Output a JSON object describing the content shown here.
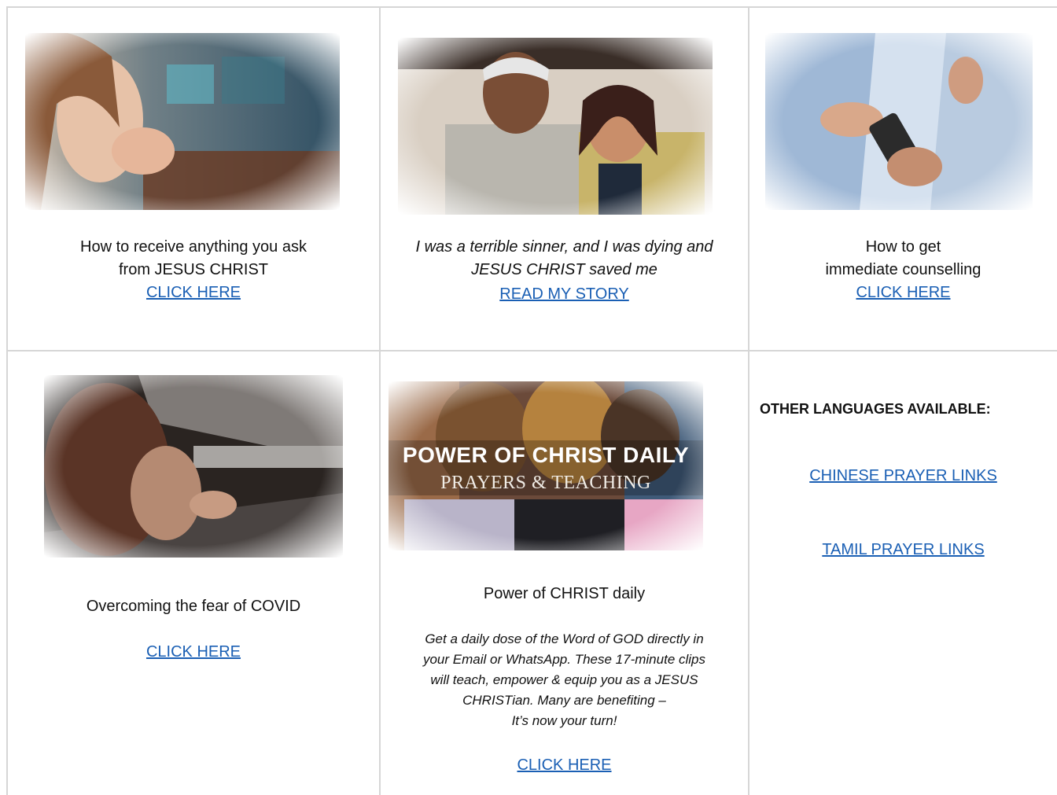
{
  "cards": [
    {
      "caption_line1": "How to receive anything you ask",
      "caption_line2": "from JESUS CHRIST",
      "link": "CLICK HERE",
      "image": "woman-praying-photo"
    },
    {
      "caption_line1": "I was a terrible sinner, and I was dying and",
      "caption_line2": "JESUS CHRIST saved me",
      "link": "READ MY STORY",
      "image": "couple-photo"
    },
    {
      "caption_line1": "How to get",
      "caption_line2": "immediate counselling",
      "link": "CLICK HERE",
      "image": "phone-hands-photo"
    },
    {
      "caption_line1": "Overcoming the fear of COVID",
      "link": "CLICK HERE",
      "image": "child-peeking-photo"
    },
    {
      "banner_title": "POWER OF CHRIST DAILY",
      "banner_subtitle": "PRAYERS & TEACHING",
      "caption_line1": "Power of CHRIST daily",
      "description_lines": [
        "Get a daily dose of the Word of GOD directly in",
        "your Email or WhatsApp. These 17-minute clips",
        "will teach, empower & equip you as a JESUS",
        "CHRISTian. Many are benefiting –",
        "It’s now your turn!"
      ],
      "link": "CLICK HERE",
      "image": "group-hug-banner"
    }
  ],
  "languages": {
    "heading": "OTHER LANGUAGES AVAILABLE:",
    "links": [
      "CHINESE PRAYER LINKS",
      "TAMIL PRAYER LINKS"
    ]
  },
  "colors": {
    "link": "#1a5fb4",
    "grid": "#d6d6d6"
  }
}
